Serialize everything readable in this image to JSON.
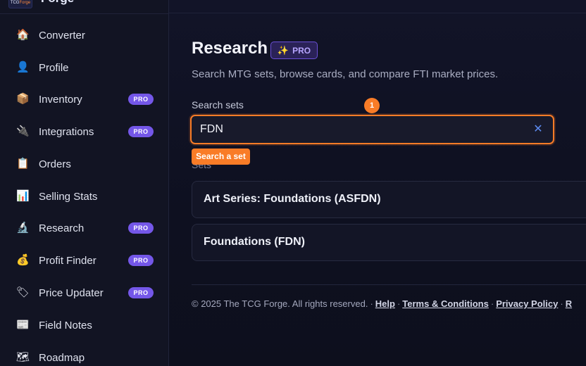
{
  "brand": {
    "logo_text": "TCG",
    "logo_text_accent": "Forge",
    "name": "Forge"
  },
  "sidebar": {
    "items": [
      {
        "label": "Converter",
        "icon": "house-icon",
        "glyph": "🏠",
        "pro": false
      },
      {
        "label": "Profile",
        "icon": "user-icon",
        "glyph": "👤",
        "pro": false
      },
      {
        "label": "Inventory",
        "icon": "package-icon",
        "glyph": "📦",
        "pro": true
      },
      {
        "label": "Integrations",
        "icon": "plug-icon",
        "glyph": "🔌",
        "pro": true
      },
      {
        "label": "Orders",
        "icon": "clipboard-icon",
        "glyph": "📋",
        "pro": false
      },
      {
        "label": "Selling Stats",
        "icon": "bar-chart-icon",
        "glyph": "📊",
        "pro": false
      },
      {
        "label": "Research",
        "icon": "microscope-icon",
        "glyph": "🔬",
        "pro": true
      },
      {
        "label": "Profit Finder",
        "icon": "money-bag-icon",
        "glyph": "💰",
        "pro": true
      },
      {
        "label": "Price Updater",
        "icon": "price-tag-icon",
        "glyph": "🏷",
        "pro": true
      },
      {
        "label": "Field Notes",
        "icon": "newspaper-icon",
        "glyph": "📰",
        "pro": false
      },
      {
        "label": "Roadmap",
        "icon": "map-icon",
        "glyph": "🗺",
        "pro": false
      }
    ],
    "pro_label": "PRO"
  },
  "main": {
    "title": "Research",
    "badge": {
      "icon": "sparkles-icon",
      "glyph": "✨",
      "label": "PRO"
    },
    "subtitle": "Search MTG sets, browse cards, and compare FTI market prices.",
    "search": {
      "label": "Search sets",
      "value": "FDN",
      "placeholder": "",
      "clear_glyph": "✕"
    },
    "step_marker": "1",
    "hint": "Search a set",
    "section_label": "Sets",
    "sets": [
      {
        "name": "Art Series: Foundations (ASFDN)"
      },
      {
        "name": "Foundations (FDN)"
      }
    ]
  },
  "footer": {
    "copyright": "© 2025 The TCG Forge. All rights reserved.",
    "links": [
      "Help",
      "Terms & Conditions",
      "Privacy Policy",
      "R"
    ]
  },
  "colors": {
    "accent_orange": "#f97c27",
    "pro_purple": "#7457e8",
    "background": "#0f1120"
  }
}
